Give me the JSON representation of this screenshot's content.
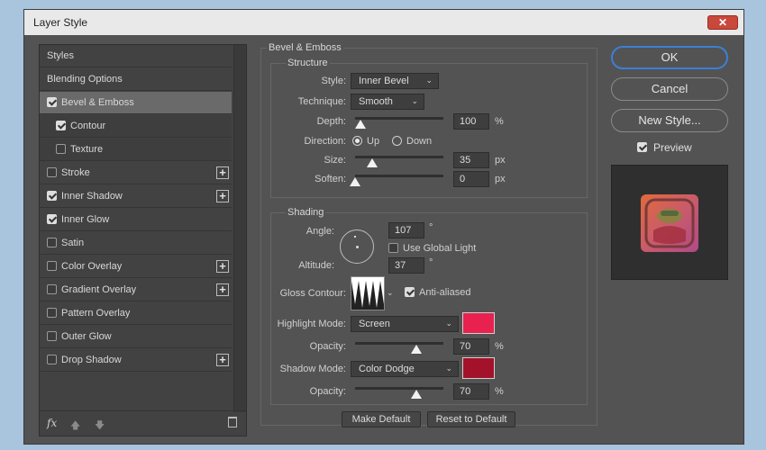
{
  "window": {
    "title": "Layer Style",
    "close_icon": "✕"
  },
  "stylelist": {
    "items": [
      {
        "label": "Styles"
      },
      {
        "label": "Blending Options"
      },
      {
        "label": "Bevel & Emboss",
        "checked": true
      },
      {
        "label": "Contour",
        "checked": true
      },
      {
        "label": "Texture",
        "checked": false
      },
      {
        "label": "Stroke",
        "checked": false
      },
      {
        "label": "Inner Shadow",
        "checked": true
      },
      {
        "label": "Inner Glow",
        "checked": true
      },
      {
        "label": "Satin",
        "checked": false
      },
      {
        "label": "Color Overlay",
        "checked": false
      },
      {
        "label": "Gradient Overlay",
        "checked": false
      },
      {
        "label": "Pattern Overlay",
        "checked": false
      },
      {
        "label": "Outer Glow",
        "checked": false
      },
      {
        "label": "Drop Shadow",
        "checked": false
      }
    ],
    "plus_icon": "+",
    "fx_label": "fx",
    "up_arrow": "🡅",
    "down_arrow": "🡇"
  },
  "bevel": {
    "section_title": "Bevel & Emboss",
    "structure_title": "Structure",
    "style_label": "Style:",
    "style_value": "Inner Bevel",
    "technique_label": "Technique:",
    "technique_value": "Smooth",
    "depth_label": "Depth:",
    "depth_value": "100",
    "depth_unit": "%",
    "direction_label": "Direction:",
    "dir_up": "Up",
    "dir_down": "Down",
    "size_label": "Size:",
    "size_value": "35",
    "size_unit": "px",
    "soften_label": "Soften:",
    "soften_value": "0",
    "soften_unit": "px"
  },
  "shading": {
    "title": "Shading",
    "angle_label": "Angle:",
    "angle_value": "107",
    "degree": "°",
    "global_light_label": "Use Global Light",
    "altitude_label": "Altitude:",
    "altitude_value": "37",
    "gloss_label": "Gloss Contour:",
    "anti_aliased_label": "Anti-aliased",
    "highlight_mode_label": "Highlight Mode:",
    "highlight_mode_value": "Screen",
    "highlight_color": "#e8214e",
    "opacity_label": "Opacity:",
    "highlight_opacity": "70",
    "shadow_mode_label": "Shadow Mode:",
    "shadow_mode_value": "Color Dodge",
    "shadow_color": "#a3122a",
    "shadow_opacity": "70",
    "pct": "%"
  },
  "buttons": {
    "make_default": "Make Default",
    "reset_default": "Reset to Default",
    "ok": "OK",
    "cancel": "Cancel",
    "new_style": "New Style...",
    "preview": "Preview"
  },
  "chevron": "⌄"
}
